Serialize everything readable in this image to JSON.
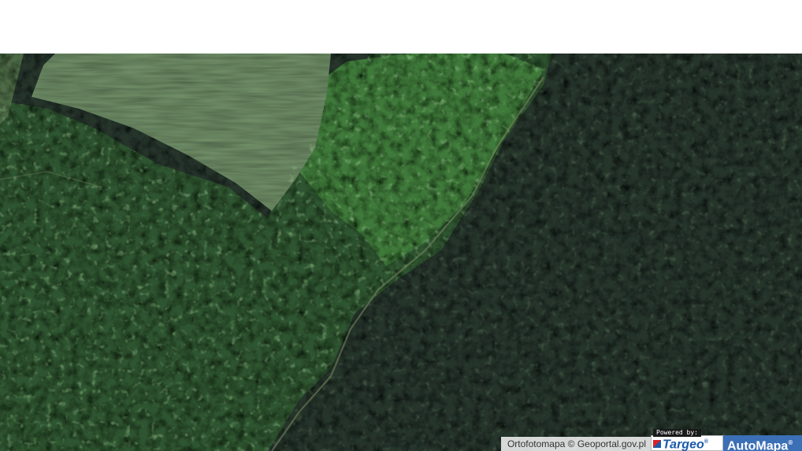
{
  "map": {
    "layer": "Ortofotomapa",
    "attribution": "Ortofotomapa © Geoportal.gov.pl",
    "powered_by": "Powered by:",
    "targeo_logo": "Targeo",
    "targeo_mark": "®",
    "automapa_logo": "AutoMapa",
    "automapa_mark": "®"
  },
  "colors": {
    "deep_forest": "#1f2b24",
    "mixed_forest": "#2b4a2a",
    "bright_canopy": "#3f7a36",
    "meadow": "#5e7a55",
    "automapa_blue": "#3b6fb6",
    "targeo_blue": "#1a5aa8",
    "targeo_red": "#d8232a"
  }
}
